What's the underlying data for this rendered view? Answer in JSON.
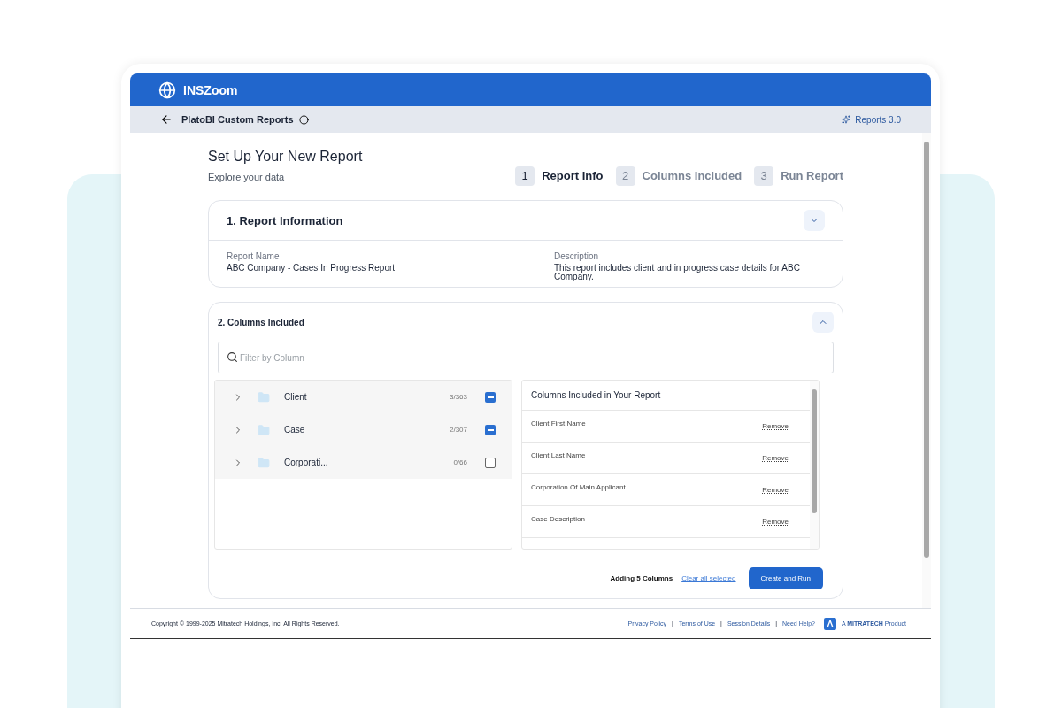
{
  "app": {
    "name": "INSZoom"
  },
  "subheader": {
    "title": "PlatoBI Custom Reports",
    "badge": "Reports 3.0"
  },
  "page": {
    "title": "Set Up Your New Report",
    "subtitle": "Explore your data"
  },
  "steps": [
    {
      "number": "1",
      "label": "Report Info",
      "selected": true
    },
    {
      "number": "2",
      "label": "Columns Included",
      "selected": false
    },
    {
      "number": "3",
      "label": "Run Report",
      "selected": false
    }
  ],
  "report_info": {
    "title": "1. Report Information",
    "fields": [
      {
        "label": "Report Name",
        "value": "ABC Company - Cases In Progress Report"
      },
      {
        "label": "Description",
        "value": "This report includes client and in progress case details for ABC Company."
      }
    ]
  },
  "columns_section": {
    "title": "2. Columns Included",
    "filter": {
      "placeholder": "Filter by Column"
    },
    "tree": [
      {
        "label": "Client",
        "count": "3/363",
        "partial": true
      },
      {
        "label": "Case",
        "count": "2/307",
        "partial": true
      },
      {
        "label": "Corporati...",
        "count": "0/66",
        "partial": false
      }
    ],
    "included": {
      "title": "Columns Included in Your Report",
      "rows": [
        {
          "name": "Client First Name",
          "action": "Remove"
        },
        {
          "name": "Client Last Name",
          "action": "Remove"
        },
        {
          "name": "Corporation Of Main Applicant",
          "action": "Remove"
        },
        {
          "name": "Case Description",
          "action": "Remove"
        }
      ]
    },
    "summary": "Adding 5 Columns",
    "clear_link": "Clear all selected",
    "submit": "Create and Run"
  },
  "footer": {
    "copyright": "Copyright © 1999-2025 Mitratech Holdings, Inc. All Rights Reserved.",
    "links": [
      "Privacy Policy",
      "Terms of Use",
      "Session Details",
      "Need Help?"
    ],
    "separators": [
      "|",
      "|",
      "|"
    ],
    "brand": "A **MITRATECH** Product"
  }
}
